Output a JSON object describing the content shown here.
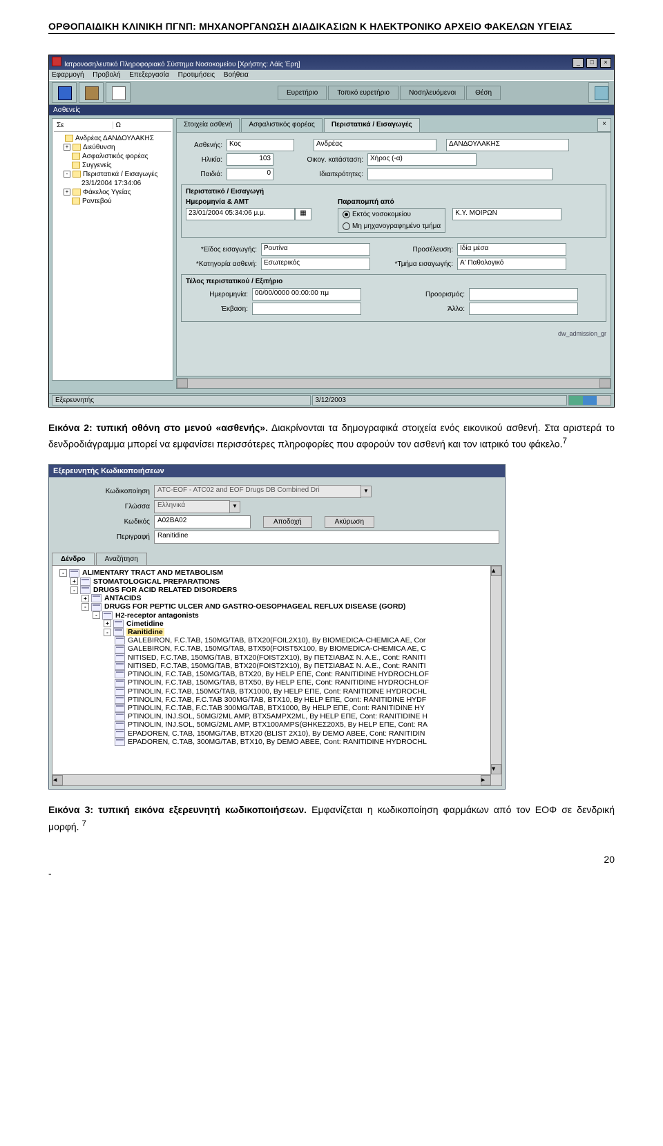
{
  "header": "ΟΡΘΟΠΑΙΔΙΚΗ ΚΛΙΝΙΚΗ ΠΓΝΠ: ΜΗΧΑΝΟΡΓΑΝΩΣΗ ΔΙΑΔΙΚΑΣΙΩΝ Κ ΗΛΕΚΤΡΟΝΙΚΟ ΑΡΧΕΙΟ ΦΑΚΕΛΩΝ ΥΓΕΙΑΣ",
  "caption1_a": "Εικόνα 2: τυπική οθόνη στο μενού «ασθενής».",
  "caption1_b": " Διακρίνονται τα δημογραφικά στοιχεία ενός εικονικού ασθενή. Στα αριστερά το δενδροδιάγραμμα μπορεί να εμφανίσει περισσότερες πληροφορίες που αφορούν τον ασθενή και τον ιατρικό του φάκελο.",
  "caption1_sup": "7",
  "caption2_a": "Εικόνα 3: τυπική εικόνα εξερευνητή κωδικοποιήσεων.",
  "caption2_b": " Εμφανίζεται η κωδικοποίηση φαρμάκων από τον ΕΟΦ σε δενδρική μορφή. ",
  "caption2_sup": "7",
  "page_number": "20",
  "dash": "-",
  "s1": {
    "title": "Ιατρονοσηλευτικό Πληροφοριακό Σύστημα Νοσοκομείου [Χρήστης: Λάϊς Έρη]",
    "menu": [
      "Εφαρμογή",
      "Προβολή",
      "Επεξεργασία",
      "Προτιμήσεις",
      "Βοήθεια"
    ],
    "left_title": "Ασθενείς",
    "toolbar_tabs": [
      "Ευρετήριο",
      "Τοπικό ευρετήριο",
      "Νοσηλευόμενοι",
      "Θέση"
    ],
    "tree": [
      {
        "ind": 0,
        "box": "",
        "icon": "fold",
        "label": "Ανδρέας ΔΑΝΔΟΥΛΑΚΗΣ"
      },
      {
        "ind": 1,
        "box": "+",
        "icon": "fold",
        "label": "Διεύθυνση"
      },
      {
        "ind": 1,
        "box": "",
        "icon": "fold",
        "label": "Ασφαλιστικός φορέας"
      },
      {
        "ind": 1,
        "box": "",
        "icon": "fold",
        "label": "Συγγενείς"
      },
      {
        "ind": 1,
        "box": "-",
        "icon": "fold",
        "label": "Περιστατικά / Εισαγωγές"
      },
      {
        "ind": 2,
        "box": "",
        "icon": "",
        "label": "23/1/2004 17:34:06"
      },
      {
        "ind": 1,
        "box": "+",
        "icon": "fold",
        "label": "Φάκελος Υγείας"
      },
      {
        "ind": 1,
        "box": "",
        "icon": "fold",
        "label": "Ραντεβού"
      }
    ],
    "tabs": [
      "Στοιχεία ασθενή",
      "Ασφαλιστικός φορέας",
      "Περιστατικά / Εισαγωγές"
    ],
    "fields": {
      "patient_label": "Ασθενής:",
      "patient_title": "Κος",
      "patient_first": "Ανδρέας",
      "patient_last": "ΔΑΝΔΟΥΛΑΚΗΣ",
      "age_label": "Ηλικία:",
      "age": "103",
      "fam_label": "Οικογ. κατάσταση:",
      "fam": "Χήρος (-α)",
      "kids_label": "Παιδιά:",
      "kids": "0",
      "idiot_label": "Ιδιαιτερότητες:",
      "idiot": "",
      "g1_title": "Περιστατικό / Εισαγωγή",
      "g1_date_label": "Ημερομηνία & ΑΜΤ",
      "g1_date": "23/01/2004 05:34:06 μ.μ.",
      "g1_ref_title": "Παραπομπή από",
      "radio1": "Εκτός νοσοκομείου",
      "radio2": "Μη μηχανογραφημένο τμήμα",
      "radio_val": "Κ.Υ. ΜΟΙΡΩΝ",
      "eis_label": "*Είδος εισαγωγής:",
      "eis": "Ρουτίνα",
      "pros_label": "Προσέλευση:",
      "pros": "Ιδία μέσα",
      "kat_label": "*Κατηγορία ασθενή:",
      "kat": "Εσωτερικός",
      "tmima_label": "*Τμήμα εισαγωγής:",
      "tmima": "Α' Παθολογικό",
      "g2_title": "Τέλος περιστατικού / Εξιτήριο",
      "hm_label": "Ημερομηνία:",
      "hm": "00/00/0000 00:00:00 πμ",
      "proor_label": "Προορισμός:",
      "ekb_label": "Έκβαση:",
      "allo_label": "Άλλο:",
      "status_right": "dw_admission_gr"
    },
    "statusbar_left": "Εξερευνητής",
    "statusbar_date": "3/12/2003"
  },
  "s2": {
    "title": "Εξερευνητής Κωδικοποιήσεων",
    "rows": [
      {
        "label": "Κωδικοποίηση",
        "value": "ATC-EOF - ATC02 and EOF Drugs DB Combined Dri",
        "dd": true
      },
      {
        "label": "Γλώσσα",
        "value": "Ελληνικά",
        "dd": true
      },
      {
        "label": "Κωδικός",
        "value": "A02BA02",
        "btns": [
          "Αποδοχή",
          "Ακύρωση"
        ]
      },
      {
        "label": "Περιγραφή",
        "value": "Ranitidine"
      }
    ],
    "tabs": [
      "Δένδρο",
      "Αναζήτηση"
    ],
    "tree": [
      {
        "lvl": 0,
        "box": "-",
        "text": "ALIMENTARY TRACT AND METABOLISM"
      },
      {
        "lvl": 1,
        "box": "+",
        "text": "STOMATOLOGICAL PREPARATIONS"
      },
      {
        "lvl": 1,
        "box": "-",
        "text": "DRUGS FOR ACID RELATED DISORDERS"
      },
      {
        "lvl": 2,
        "box": "+",
        "text": "ANTACIDS"
      },
      {
        "lvl": 2,
        "box": "-",
        "text": "DRUGS FOR PEPTIC ULCER AND GASTRO-OESOPHAGEAL REFLUX DISEASE (GORD)"
      },
      {
        "lvl": 3,
        "box": "-",
        "text": "H2-receptor antagonists"
      },
      {
        "lvl": 4,
        "box": "+",
        "text": "Cimetidine"
      },
      {
        "lvl": 4,
        "box": "-",
        "text": "Ranitidine",
        "hl": true
      },
      {
        "lvl": 5,
        "leaf": true,
        "text": "GALEBIRON, F.C.TAB, 150MG/TAB, BTX20(FOIL2X10), By BIOMEDICA-CHEMICA AE, Cor"
      },
      {
        "lvl": 5,
        "leaf": true,
        "text": "GALEBIRON, F.C.TAB, 150MG/TAB, BTX50(FOIST5X100, By BIOMEDICA-CHEMICA AE, C"
      },
      {
        "lvl": 5,
        "leaf": true,
        "text": "NITISED, F.C.TAB, 150MG/TAB, BTX20(FOIST2X10), By ΠΕΤΣΙΑΒΑΣ Ν. Α.Ε., Cont: RANITI"
      },
      {
        "lvl": 5,
        "leaf": true,
        "text": "NITISED, F.C.TAB, 150MG/TAB, BTX20(FOIST2X10), By ΠΕΤΣΙΑΒΑΣ Ν. Α.Ε., Cont: RANITI"
      },
      {
        "lvl": 5,
        "leaf": true,
        "text": "PTINOLIN, F.C.TAB, 150MG/TAB, BTX20, By HELP ΕΠΕ, Cont: RANITIDINE HYDROCHLOF"
      },
      {
        "lvl": 5,
        "leaf": true,
        "text": "PTINOLIN, F.C.TAB, 150MG/TAB, BTX50, By HELP ΕΠΕ, Cont: RANITIDINE HYDROCHLOF"
      },
      {
        "lvl": 5,
        "leaf": true,
        "text": "PTINOLIN, F.C.TAB, 150MG/TAB, BTX1000, By HELP ΕΠΕ, Cont: RANITIDINE HYDROCHL"
      },
      {
        "lvl": 5,
        "leaf": true,
        "text": "PTINOLIN, F.C.TAB, F.C.TAB 300MG/TAB, BTX10, By HELP ΕΠΕ, Cont: RANITIDINE HYDF"
      },
      {
        "lvl": 5,
        "leaf": true,
        "text": "PTINOLIN, F.C.TAB, F.C.TAB 300MG/TAB, BTX1000, By HELP ΕΠΕ, Cont: RANITIDINE HY"
      },
      {
        "lvl": 5,
        "leaf": true,
        "text": "PTINOLIN, INJ.SOL, 50MG/2ML AMP, BTX5AMPX2ML, By HELP ΕΠΕ, Cont: RANITIDINE H"
      },
      {
        "lvl": 5,
        "leaf": true,
        "text": "PTINOLIN, INJ.SOL, 50MG/2ML AMP, BTX100AMPS(ΘΗΚΕΣ20Χ5, By HELP ΕΠΕ, Cont: RA"
      },
      {
        "lvl": 5,
        "leaf": true,
        "text": "EPADOREN, C.TAB, 150MG/TAB, BTX20 (BLIST 2X10), By DEMO ABEE, Cont: RANITIDIN"
      },
      {
        "lvl": 5,
        "leaf": true,
        "text": "EPADOREN, C.TAB, 300MG/TAB, BTX10, By DEMO ABEE, Cont: RANITIDINE HYDROCHL"
      }
    ]
  }
}
